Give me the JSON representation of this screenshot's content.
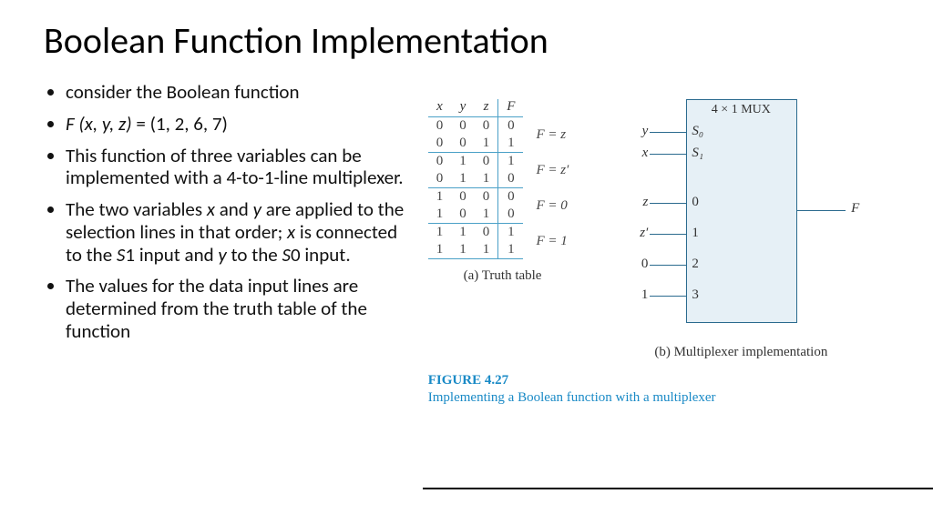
{
  "title": "Boolean Function Implementation",
  "bullets": {
    "b1": "consider the Boolean function",
    "b2_pre": "F ",
    "b2_vars": "(x, y, z)",
    "b2_post": " = (1, 2, 6, 7)",
    "b3": "This function of three variables can be implemented with a 4-to-1-line multiplexer.",
    "b4_a": "The two variables ",
    "b4_x": "x",
    "b4_b": " and ",
    "b4_y": "y",
    "b4_c": " are applied to the selection lines in that order; ",
    "b4_x2": "x",
    "b4_d": " is connected to the ",
    "b4_s1": "S",
    "b4_s1n": "1 input and ",
    "b4_y2": "y",
    "b4_e": " to the ",
    "b4_s0": "S",
    "b4_s0n": "0 input.",
    "b5": "The values for the data input lines are determined from the truth table of the function"
  },
  "tt": {
    "hx": "x",
    "hy": "y",
    "hz": "z",
    "hF": "F",
    "r": [
      [
        "0",
        "0",
        "0",
        "0"
      ],
      [
        "0",
        "0",
        "1",
        "1"
      ],
      [
        "0",
        "1",
        "0",
        "1"
      ],
      [
        "0",
        "1",
        "1",
        "0"
      ],
      [
        "1",
        "0",
        "0",
        "0"
      ],
      [
        "1",
        "0",
        "1",
        "0"
      ],
      [
        "1",
        "1",
        "0",
        "1"
      ],
      [
        "1",
        "1",
        "1",
        "1"
      ]
    ],
    "ann": [
      "F = z",
      "F = z′",
      "F = 0",
      "F = 1"
    ],
    "caption": "(a) Truth table"
  },
  "mux": {
    "title": "4 × 1 MUX",
    "sel": [
      "y",
      "x"
    ],
    "sel_in": [
      "S₀",
      "S₁"
    ],
    "data": [
      "z",
      "z′",
      "0",
      "1"
    ],
    "data_in": [
      "0",
      "1",
      "2",
      "3"
    ],
    "out": "F",
    "caption": "(b) Multiplexer implementation"
  },
  "fig": {
    "num": "FIGURE 4.27",
    "desc": "Implementing a Boolean function with a multiplexer"
  }
}
